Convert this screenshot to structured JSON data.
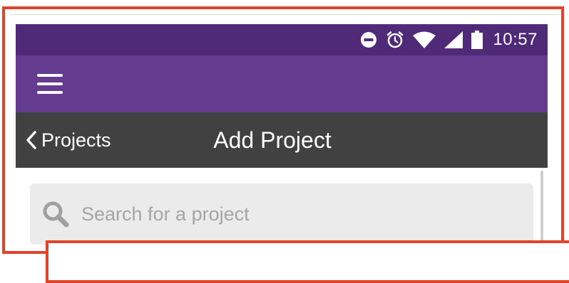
{
  "status_bar": {
    "time": "10:57",
    "icons": [
      "do-not-disturb-icon",
      "alarm-icon",
      "wifi-icon",
      "signal-icon",
      "battery-icon"
    ]
  },
  "app_bar": {
    "menu_icon": "hamburger-menu-icon"
  },
  "nav_bar": {
    "back_label": "Projects",
    "title": "Add Project"
  },
  "search": {
    "placeholder": "Search for a project",
    "icon": "search-icon"
  },
  "colors": {
    "status_bar": "#4e2a79",
    "app_bar": "#633b8f",
    "nav_bar": "#414141",
    "search_field": "#ebebeb",
    "annotation": "#e0432a"
  }
}
